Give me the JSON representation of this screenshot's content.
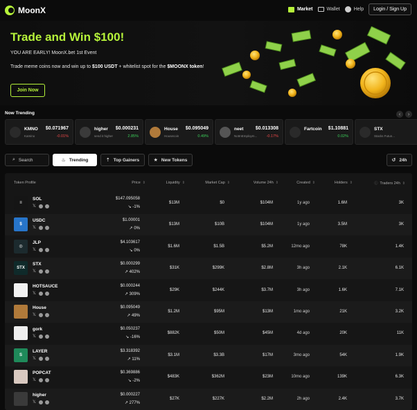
{
  "app": {
    "name": "MoonX"
  },
  "nav": {
    "market": "Market",
    "wallet": "Wallet",
    "help": "Help",
    "login": "Login / Sign Up"
  },
  "hero": {
    "title": "Trade and Win $100!",
    "subtitle": "YOU ARE EARLY! MoonX.bet 1st Event",
    "desc_pre": "Trade meme coins now and win up to ",
    "desc_b1": "$100 USDT",
    "desc_mid": " + whitelist spot for the ",
    "desc_b2": "$MOONX token",
    "desc_end": "!",
    "cta": "Join Now"
  },
  "trending": {
    "title": "Now Trending",
    "prev": "‹",
    "next": "›",
    "cards": [
      {
        "name": "KMNO",
        "sub": "Kamino",
        "price": "$0.071967",
        "change": "-0.01%",
        "dir": "down",
        "color": "#2a2a2a"
      },
      {
        "name": "higher",
        "sub": "send it higher",
        "price": "$0.000231",
        "change": "2.85%",
        "dir": "up",
        "color": "#3a3a3a"
      },
      {
        "name": "House",
        "sub": "Housecoin",
        "price": "$0.095049",
        "change": "0.49%",
        "dir": "up",
        "color": "#b07a3a"
      },
      {
        "name": "neet",
        "sub": "NotInEmploym...",
        "price": "$0.013308",
        "change": "-0.17%",
        "dir": "down",
        "color": "#555555"
      },
      {
        "name": "Fartcoin",
        "sub": "",
        "price": "$1.10881",
        "change": "0.02%",
        "dir": "up",
        "color": "#2a2a2a"
      },
      {
        "name": "STX",
        "sub": "Stacks Futun...",
        "price": "",
        "change": "",
        "dir": "up",
        "color": "#2a2a2a"
      }
    ]
  },
  "filters": {
    "search": "Search",
    "trending": "Trending",
    "top_gainers": "Top Gainers",
    "new_tokens": "New Tokens",
    "period": "24h"
  },
  "table": {
    "headers": {
      "token": "Token Profile",
      "price": "Price",
      "liquidity": "Liquidity",
      "mcap": "Market Cap",
      "volume": "Volume 24h",
      "created": "Created",
      "holders": "Holders",
      "traders": "Traders 24h"
    },
    "rows": [
      {
        "name": "SOL",
        "price": "$147.095058",
        "change": "-1%",
        "dir": "down",
        "liq": "$13M",
        "mcap": "$0",
        "vol": "$104M",
        "created": "1y ago",
        "holders": "1.6M",
        "traders": "3K",
        "av": "#151515",
        "glyph": "≡"
      },
      {
        "name": "USDC",
        "price": "$1.00001",
        "change": "0%",
        "dir": "up",
        "liq": "$13M",
        "mcap": "$10B",
        "vol": "$104M",
        "created": "1y ago",
        "holders": "3.5M",
        "traders": "3K",
        "av": "#2775ca",
        "glyph": "$"
      },
      {
        "name": "JLP",
        "price": "$4.103617",
        "change": "0%",
        "dir": "down",
        "liq": "$1.6M",
        "mcap": "$1.5B",
        "vol": "$5.2M",
        "created": "12mo ago",
        "holders": "78K",
        "traders": "1.4K",
        "av": "#1c2a2e",
        "glyph": "◎"
      },
      {
        "name": "STX",
        "price": "$0.000299",
        "change": "402%",
        "dir": "up",
        "liq": "$31K",
        "mcap": "$299K",
        "vol": "$2.8M",
        "created": "3h ago",
        "holders": "2.1K",
        "traders": "6.1K",
        "av": "#0f2a2a",
        "glyph": "STX"
      },
      {
        "name": "HOTSAUCE",
        "price": "$0.000244",
        "change": "309%",
        "dir": "up",
        "liq": "$29K",
        "mcap": "$244K",
        "vol": "$3.7M",
        "created": "3h ago",
        "holders": "1.6K",
        "traders": "7.1K",
        "av": "#f2f2f2",
        "glyph": ""
      },
      {
        "name": "House",
        "price": "$0.095049",
        "change": "49%",
        "dir": "up",
        "liq": "$1.2M",
        "mcap": "$95M",
        "vol": "$13M",
        "created": "1mo ago",
        "holders": "21K",
        "traders": "3.2K",
        "av": "#b07a3a",
        "glyph": ""
      },
      {
        "name": "gork",
        "price": "$0.050237",
        "change": "-16%",
        "dir": "down",
        "liq": "$882K",
        "mcap": "$50M",
        "vol": "$45M",
        "created": "4d ago",
        "holders": "20K",
        "traders": "11K",
        "av": "#efefef",
        "glyph": ""
      },
      {
        "name": "LAYER",
        "price": "$3.318392",
        "change": "11%",
        "dir": "up",
        "liq": "$3.1M",
        "mcap": "$3.3B",
        "vol": "$17M",
        "created": "3mo ago",
        "holders": "54K",
        "traders": "1.9K",
        "av": "#1f8a5a",
        "glyph": "S"
      },
      {
        "name": "POPCAT",
        "price": "$0.369886",
        "change": "-2%",
        "dir": "down",
        "liq": "$483K",
        "mcap": "$362M",
        "vol": "$23M",
        "created": "10mo ago",
        "holders": "139K",
        "traders": "6.3K",
        "av": "#d9c9c0",
        "glyph": ""
      },
      {
        "name": "higher",
        "price": "$0.000227",
        "change": "277%",
        "dir": "up",
        "liq": "$27K",
        "mcap": "$227K",
        "vol": "$2.2M",
        "created": "2h ago",
        "holders": "2.4K",
        "traders": "3.7K",
        "av": "#3a3a3a",
        "glyph": ""
      }
    ]
  }
}
